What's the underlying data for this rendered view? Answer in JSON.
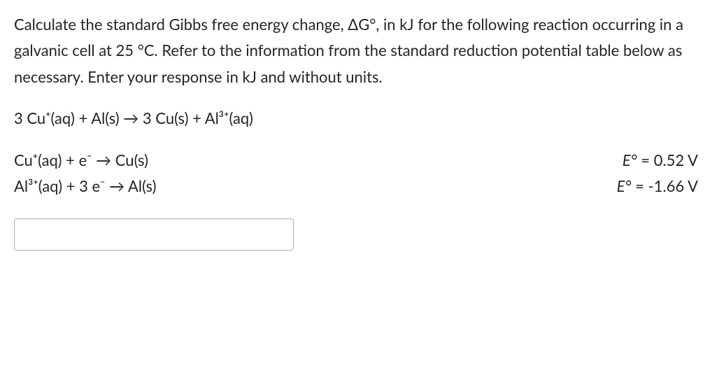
{
  "intro": "Calculate the standard Gibbs free energy change, ΔG°, in kJ for the following reaction occurring in a galvanic cell at 25 °C. Refer to the information from the standard reduction potential table below as necessary. Enter your response in kJ and without units.",
  "reaction": "3 Cu⁺(aq) + Al(s) → 3 Cu(s) + Al³⁺(aq)",
  "half_reactions": [
    {
      "equation": "Cu⁺(aq) + e⁻ → Cu(s)",
      "potential_label": "E°",
      "potential_value": "= 0.52 V"
    },
    {
      "equation": "Al³⁺(aq) + 3 e⁻ → Al(s)",
      "potential_label": "E°",
      "potential_value": "= -1.66 V"
    }
  ],
  "answer": {
    "value": "",
    "placeholder": ""
  }
}
